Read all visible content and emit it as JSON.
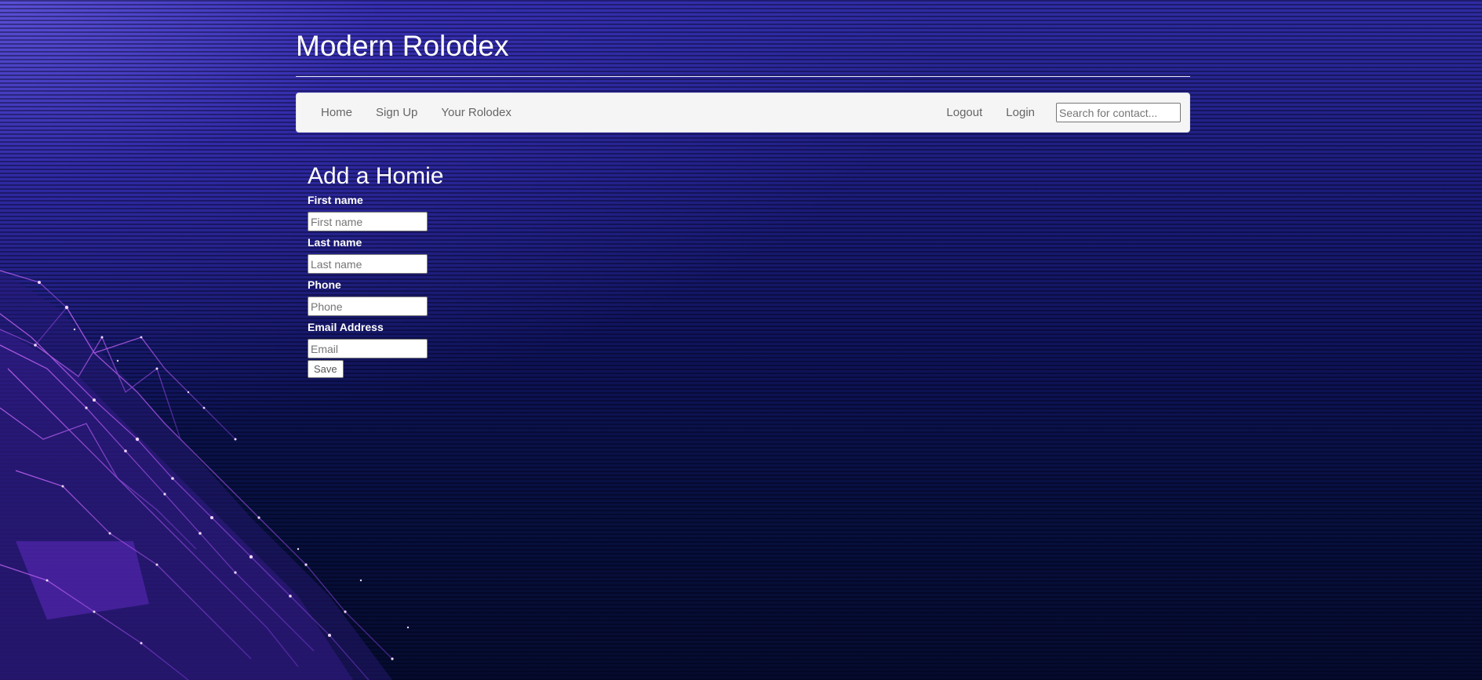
{
  "header": {
    "title": "Modern Rolodex"
  },
  "nav": {
    "left_links": [
      "Home",
      "Sign Up",
      "Your Rolodex"
    ],
    "right_links": [
      "Logout",
      "Login"
    ],
    "search_placeholder": "Search for contact..."
  },
  "form": {
    "heading": "Add a Homie",
    "fields": [
      {
        "label": "First name",
        "placeholder": "First name"
      },
      {
        "label": "Last name",
        "placeholder": "Last name"
      },
      {
        "label": "Phone",
        "placeholder": "Phone"
      },
      {
        "label": "Email Address",
        "placeholder": "Email"
      }
    ],
    "save_label": "Save"
  },
  "theme": {
    "background_top": "#2f2ca3",
    "background_bottom": "#050b2e",
    "accent_network": "#c25cf0",
    "navbar_bg": "#f5f5f5",
    "text_light": "#ffffff"
  }
}
